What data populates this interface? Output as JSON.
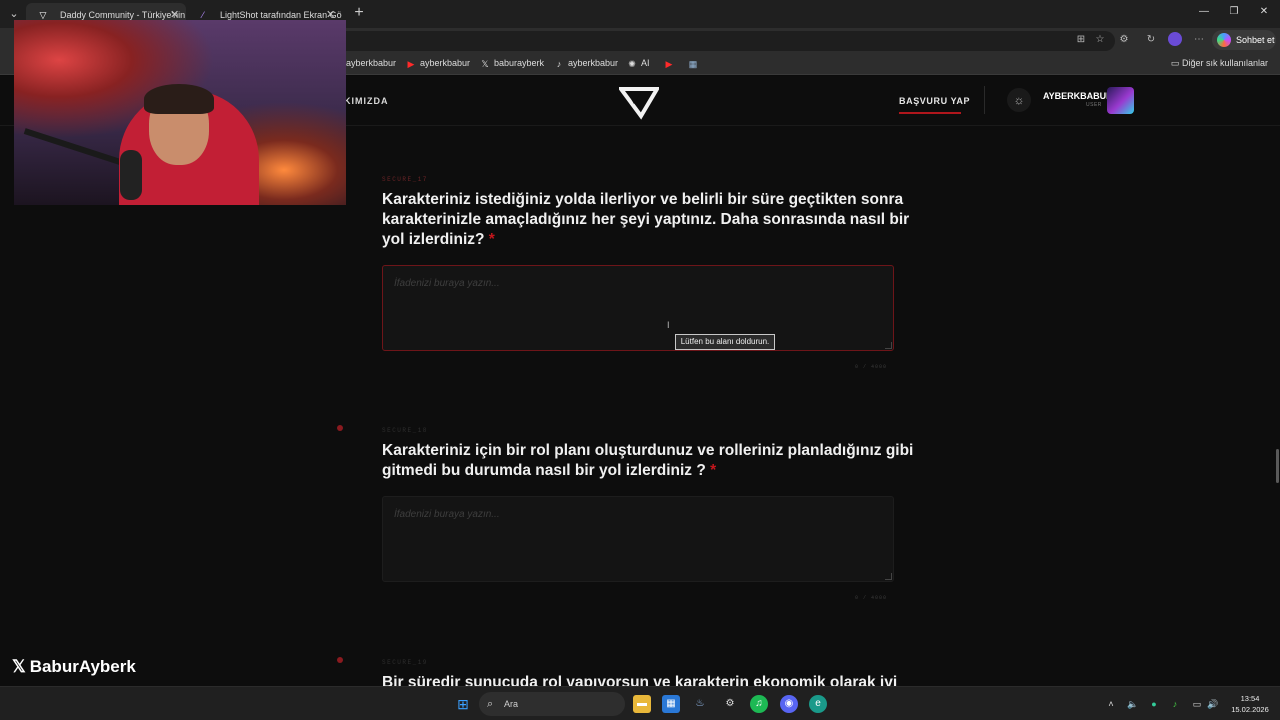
{
  "browser": {
    "tabs": [
      {
        "title": "Daddy Community - Türkiye'nin En",
        "favicon": "community-logo-icon",
        "active": true
      },
      {
        "title": "LightShot tarafından Ekran Görünt",
        "favicon": "feather-icon",
        "active": false
      }
    ],
    "chat_button": "Sohbet et",
    "bookmarks": [
      {
        "label": "ayberkbabur",
        "icon": "youtube-icon"
      },
      {
        "label": "ayberkbabur",
        "icon": "youtube-icon"
      },
      {
        "label": "baburayberk",
        "icon": "x-icon"
      },
      {
        "label": "ayberkbabur",
        "icon": "tiktok-icon"
      },
      {
        "label": "AI",
        "icon": "openai-icon"
      },
      {
        "label": "",
        "icon": "youtube-icon"
      },
      {
        "label": "",
        "icon": "image-icon"
      }
    ],
    "other_bookmarks": "Diğer sık kullanılanlar"
  },
  "site": {
    "nav_left": "KIMIZDA",
    "apply_label": "BAŞVURU YAP",
    "username": "AYBERKBABUR",
    "user_role": "USER"
  },
  "questions": [
    {
      "code": "SECURE_17",
      "text": "Karakteriniz istediğiniz yolda ilerliyor ve belirli bir süre geçtikten sonra karakterinizle amaçladığınız her şeyi yaptınız. Daha sonrasında nasıl bir yol izlerdiniz?",
      "required_mark": "*",
      "placeholder": "İfadenizi buraya yazın...",
      "counter": "0 / 4000"
    },
    {
      "code": "SECURE_18",
      "text": "Karakteriniz için bir rol planı oluşturdunuz ve rolleriniz planladığınız gibi gitmedi bu durumda nasıl bir yol izlerdiniz ?",
      "required_mark": "*",
      "placeholder": "İfadenizi buraya yazın...",
      "counter": "0 / 4000"
    },
    {
      "code": "SECURE_19",
      "text": "Bir süredir sunucuda rol yapıyorsun ve karakterin ekonomik olarak iyi"
    }
  ],
  "validation_tooltip": "Lütfen bu alanı doldurun.",
  "overlay": {
    "x_handle": "BaburAyberk"
  },
  "taskbar": {
    "search_label": "Ara",
    "time": "13:54",
    "date": "15.02.2026"
  },
  "colors": {
    "accent_red": "#b0161c",
    "required_red": "#c4161c",
    "page_bg": "#0d0d0d"
  }
}
